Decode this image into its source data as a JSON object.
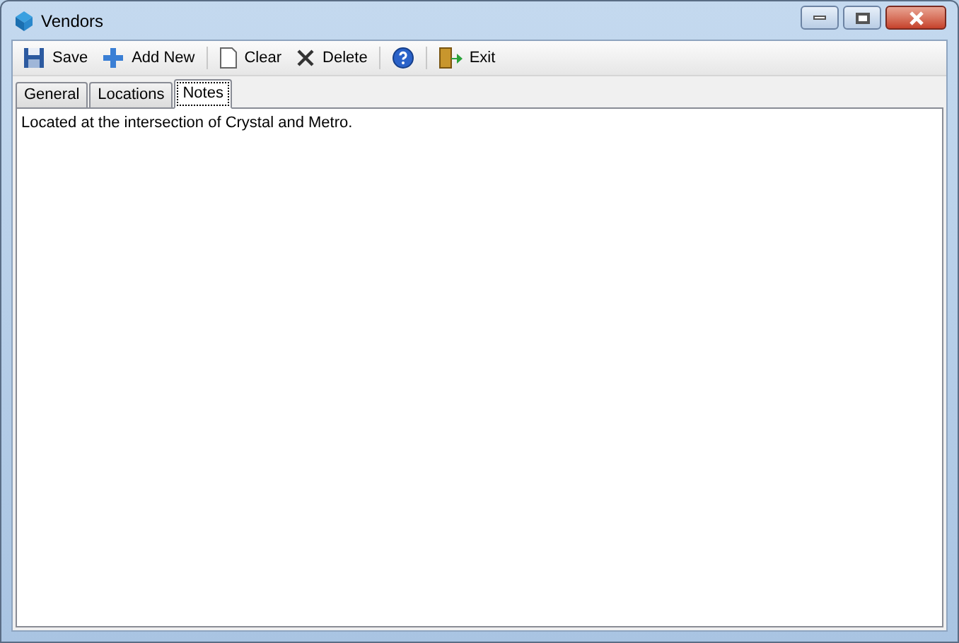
{
  "window": {
    "title": "Vendors"
  },
  "toolbar": [
    {
      "kind": "save",
      "label": "Save"
    },
    {
      "kind": "add",
      "label": "Add New"
    },
    {
      "kind": "separator"
    },
    {
      "kind": "clear",
      "label": "Clear"
    },
    {
      "kind": "delete",
      "label": "Delete"
    },
    {
      "kind": "separator"
    },
    {
      "kind": "help"
    },
    {
      "kind": "separator"
    },
    {
      "kind": "exit",
      "label": "Exit"
    }
  ],
  "tabs": [
    {
      "label": "General",
      "selected": false
    },
    {
      "label": "Locations",
      "selected": false
    },
    {
      "label": "Notes",
      "selected": true
    }
  ],
  "notes": {
    "value": "Located at the intersection of Crystal and Metro."
  }
}
